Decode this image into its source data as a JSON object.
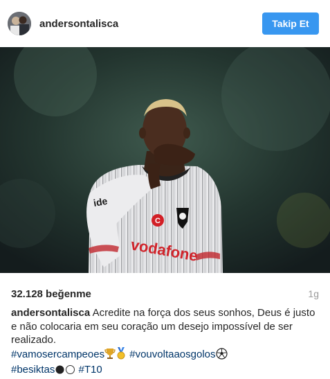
{
  "header": {
    "username": "andersontalisca",
    "follow_label": "Takip Et"
  },
  "post": {
    "likes": "32.128 beğenme",
    "time": "1g",
    "caption_user": "andersontalisca",
    "caption_text": "Acredite na força dos seus sonhos, Deus é justo e não colocaria em seu coração um desejo impossível de ser realizado.",
    "hashtags": {
      "vamosercampeoes": "#vamosercampeoes",
      "vouvoltaaosgolos": "#vouvoltaaosgolos",
      "besiktas": "#besiktas",
      "t10": "#T10"
    },
    "photo_texts": {
      "sponsor": "vodafone",
      "brand": "ide"
    }
  },
  "colors": {
    "accent": "#3897f0",
    "hashtag": "#003569",
    "muted": "#999999"
  },
  "icons": [
    "trophy-emoji",
    "medal-emoji",
    "soccer-ball-emoji",
    "black-circle-emoji",
    "white-circle-emoji"
  ]
}
